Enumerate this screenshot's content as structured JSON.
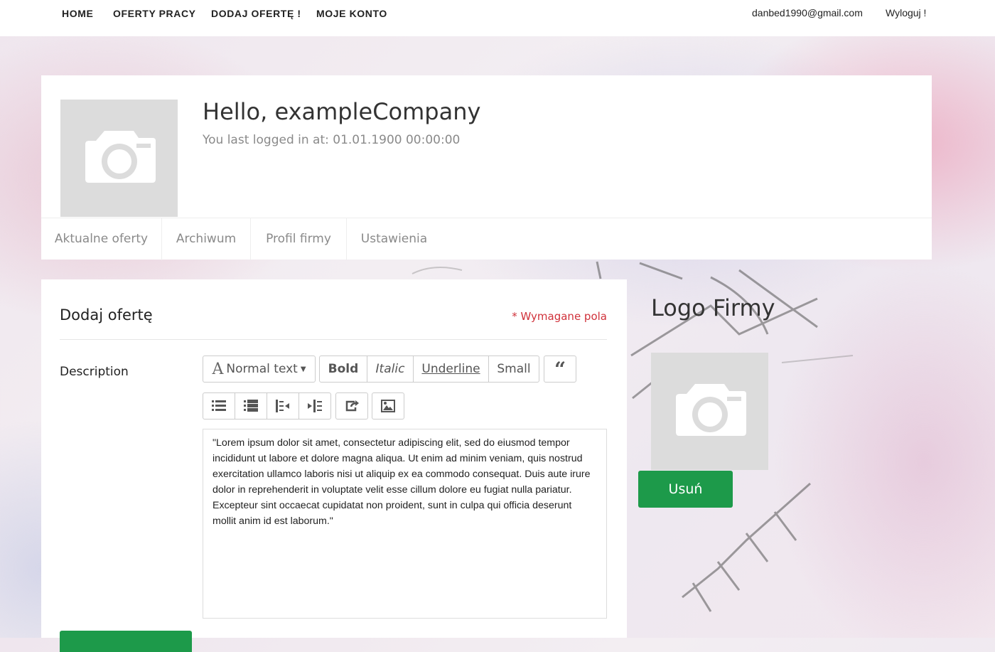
{
  "nav": {
    "links": [
      "HOME",
      "OFERTY PRACY",
      "DODAJ OFERTĘ !",
      "MOJE KONTO"
    ],
    "email": "danbed1990@gmail.com",
    "logout": "Wyloguj !"
  },
  "profile": {
    "greeting": "Hello, exampleCompany",
    "last_login": "You last logged in at: 01.01.1900 00:00:00",
    "avatar_icon": "camera-icon"
  },
  "tabs": [
    "Aktualne oferty",
    "Archiwum",
    "Profil firmy",
    "Ustawienia"
  ],
  "form": {
    "title": "Dodaj ofertę",
    "required_note": "* Wymagane pola",
    "description_label": "Description",
    "toolbar": {
      "font_style": "Normal text",
      "bold": "Bold",
      "italic": "Italic",
      "underline": "Underline",
      "small": "Small",
      "quote_icon": "quote-icon",
      "icons": [
        "unordered-list-icon",
        "ordered-list-icon",
        "outdent-icon",
        "indent-icon",
        "link-icon",
        "image-icon"
      ]
    },
    "description_text": "\"Lorem ipsum dolor sit amet, consectetur adipiscing elit, sed do eiusmod tempor incididunt ut labore et dolore magna aliqua. Ut enim ad minim veniam, quis nostrud exercitation ullamco laboris nisi ut aliquip ex ea commodo consequat. Duis aute irure dolor in reprehenderit in voluptate velit esse cillum dolore eu fugiat nulla pariatur. Excepteur sint occaecat cupidatat non proident, sunt in culpa qui officia deserunt mollit anim id est laborum.\""
  },
  "logo": {
    "title": "Logo Firmy",
    "delete_button": "Usuń",
    "icon": "camera-icon"
  },
  "colors": {
    "accent_green": "#1d9a4a",
    "required_red": "#d0313a"
  }
}
